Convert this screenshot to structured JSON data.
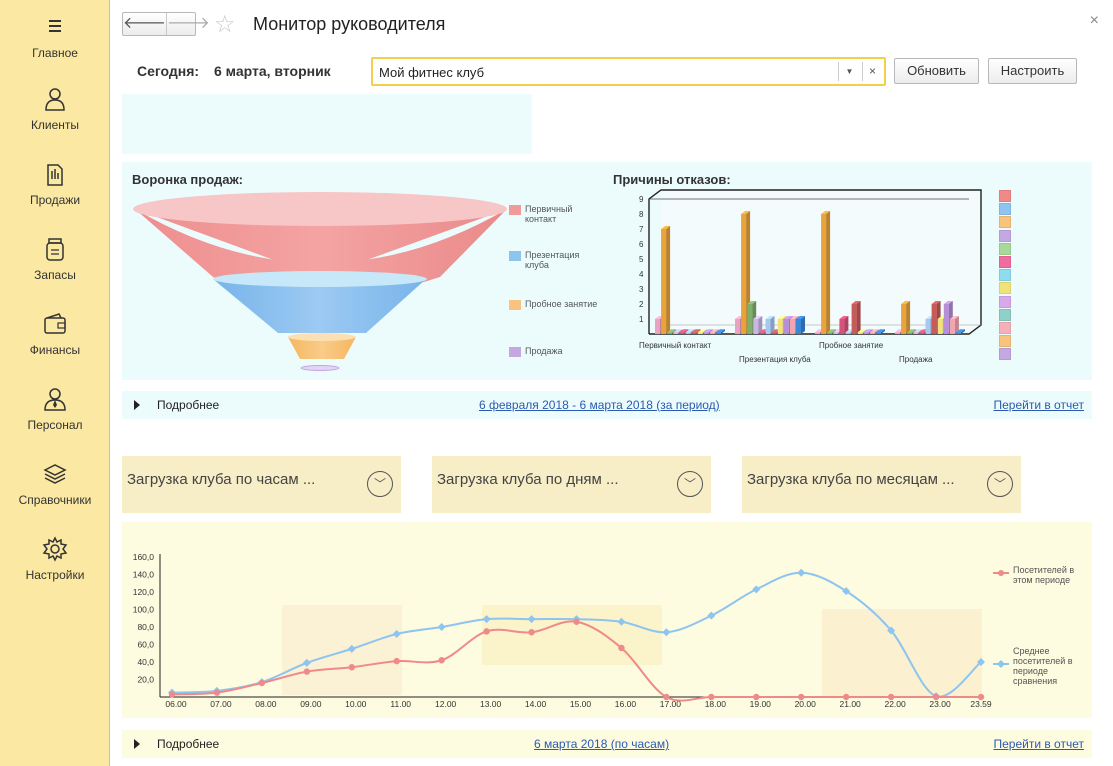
{
  "sidebar": {
    "items": [
      {
        "label": "Главное",
        "icon": "menu-icon"
      },
      {
        "label": "Клиенты",
        "icon": "person-icon"
      },
      {
        "label": "Продажи",
        "icon": "sales-icon"
      },
      {
        "label": "Запасы",
        "icon": "jar-icon"
      },
      {
        "label": "Финансы",
        "icon": "wallet-icon"
      },
      {
        "label": "Персонал",
        "icon": "staff-icon"
      },
      {
        "label": "Справочники",
        "icon": "layers-icon"
      },
      {
        "label": "Настройки",
        "icon": "gear-icon"
      }
    ]
  },
  "header": {
    "title": "Монитор руководителя",
    "back": "🡐",
    "forward": "🡒",
    "close": "×"
  },
  "toolbar": {
    "today_label": "Сегодня:",
    "today_value": "6 марта, вторник",
    "club_value": "Мой фитнес клуб",
    "refresh_label": "Обновить",
    "configure_label": "Настроить"
  },
  "funnel": {
    "title": "Воронка продаж:",
    "legend": [
      {
        "label": "Первичный контакт",
        "color": "#f19a9a"
      },
      {
        "label": "Презентация клуба",
        "color": "#8ec4f0"
      },
      {
        "label": "Пробное занятие",
        "color": "#f8c37c"
      },
      {
        "label": "Продажа",
        "color": "#c4a8e2"
      }
    ]
  },
  "refusals": {
    "title": "Причины отказов:",
    "chart_data": {
      "type": "bar",
      "categories": [
        "Первичный контакт",
        "Презентация клуба",
        "Пробное занятие",
        "Продажа"
      ],
      "series": [
        {
          "color": "#e9a3c0",
          "values": [
            1,
            1,
            0,
            0
          ]
        },
        {
          "color": "#e8a33a",
          "values": [
            7,
            8,
            8,
            2
          ]
        },
        {
          "color": "#7fb069",
          "values": [
            0,
            2,
            0,
            0
          ]
        },
        {
          "color": "#c9b6e6",
          "values": [
            0,
            1,
            0,
            0
          ]
        },
        {
          "color": "#d9527a",
          "values": [
            0,
            0,
            1,
            0
          ]
        },
        {
          "color": "#a7c8ef",
          "values": [
            0,
            1,
            0,
            1
          ]
        },
        {
          "color": "#c85a5a",
          "values": [
            0,
            0,
            2,
            2
          ]
        },
        {
          "color": "#f3e27a",
          "values": [
            0,
            1,
            0,
            1
          ]
        },
        {
          "color": "#b78ed8",
          "values": [
            0,
            1,
            0,
            2
          ]
        },
        {
          "color": "#f2a5b0",
          "values": [
            0,
            1,
            0,
            1
          ]
        },
        {
          "color": "#3a87d8",
          "values": [
            0,
            1,
            0,
            0
          ]
        }
      ],
      "yticks": [
        "1",
        "2",
        "3",
        "4",
        "5",
        "6",
        "7",
        "8",
        "9"
      ],
      "ylim": [
        0,
        9
      ]
    },
    "legend_colors": [
      "#f08a8a",
      "#8ec4f0",
      "#f8c37c",
      "#c4a8e2",
      "#a8d89a",
      "#f06ca0",
      "#8fdcf0",
      "#f0e27a",
      "#d8a8ea",
      "#8fd0c8",
      "#f5b0b8",
      "#f8c37c",
      "#c4a8e2"
    ]
  },
  "details1": {
    "more": "Подробнее",
    "period": "6 февраля 2018 - 6 марта 2018 (за период)",
    "report": "Перейти в отчет"
  },
  "load_cards": [
    {
      "label": "Загрузка клуба по часам ..."
    },
    {
      "label": "Загрузка клуба по дням ..."
    },
    {
      "label": "Загрузка клуба по месяцам ..."
    }
  ],
  "visitors": {
    "chart_data": {
      "type": "line",
      "x": [
        "06.00",
        "07.00",
        "08.00",
        "09.00",
        "10.00",
        "11.00",
        "12.00",
        "13.00",
        "14.00",
        "15.00",
        "16.00",
        "17.00",
        "18.00",
        "19.00",
        "20.00",
        "21.00",
        "22.00",
        "23.00",
        "23.59"
      ],
      "series": [
        {
          "name": "Посетителей в этом периоде",
          "color": "#ef8a8a",
          "values": [
            3,
            5,
            16,
            29,
            34,
            41,
            42,
            75,
            74,
            86,
            56,
            0,
            0,
            0,
            0,
            0,
            0,
            0,
            0
          ]
        },
        {
          "name": "Среднее посетителей в периоде сравнения",
          "color": "#8ec4f0",
          "values": [
            5,
            7,
            17,
            39,
            55,
            72,
            80,
            89,
            89,
            89,
            86,
            74,
            93,
            123,
            142,
            121,
            76,
            1,
            40
          ]
        }
      ],
      "yticks": [
        "20,0",
        "40,0",
        "60,0",
        "80,0",
        "100,0",
        "120,0",
        "140,0",
        "160,0"
      ],
      "ylim": [
        0,
        160
      ]
    }
  },
  "details2": {
    "more": "Подробнее",
    "period": "6 марта 2018 (по часам)",
    "report": "Перейти в отчет"
  }
}
